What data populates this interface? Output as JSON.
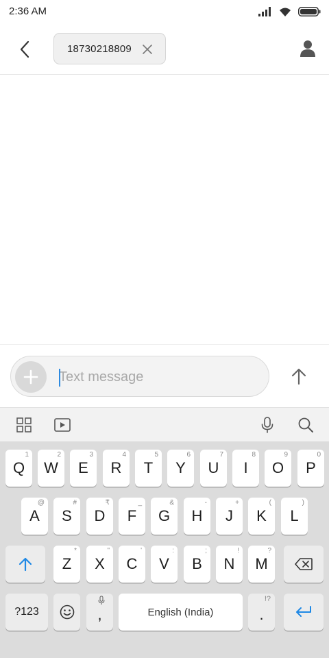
{
  "status_bar": {
    "time": "2:36 AM",
    "icons": [
      "signal-icon",
      "wifi-icon",
      "battery-icon"
    ]
  },
  "header": {
    "back_icon": "chevron-left-icon",
    "recipient": "18730218809",
    "remove_icon": "close-icon",
    "contact_icon": "person-icon"
  },
  "compose": {
    "placeholder": "Text message",
    "value": "",
    "add_icon": "plus-icon",
    "send_icon": "arrow-up-icon"
  },
  "keyboard_toolbar": {
    "icons": [
      "grid-icon",
      "sticker-play-icon",
      "microphone-icon",
      "search-icon"
    ]
  },
  "keyboard": {
    "row1": [
      {
        "label": "Q",
        "hint": "1"
      },
      {
        "label": "W",
        "hint": "2"
      },
      {
        "label": "E",
        "hint": "3"
      },
      {
        "label": "R",
        "hint": "4"
      },
      {
        "label": "T",
        "hint": "5"
      },
      {
        "label": "Y",
        "hint": "6"
      },
      {
        "label": "U",
        "hint": "7"
      },
      {
        "label": "I",
        "hint": "8"
      },
      {
        "label": "O",
        "hint": "9"
      },
      {
        "label": "P",
        "hint": "0"
      }
    ],
    "row2": [
      {
        "label": "A",
        "hint": "@"
      },
      {
        "label": "S",
        "hint": "#"
      },
      {
        "label": "D",
        "hint": "₹"
      },
      {
        "label": "F",
        "hint": "_"
      },
      {
        "label": "G",
        "hint": "&"
      },
      {
        "label": "H",
        "hint": "-"
      },
      {
        "label": "J",
        "hint": "+"
      },
      {
        "label": "K",
        "hint": "("
      },
      {
        "label": "L",
        "hint": ")"
      }
    ],
    "row3": [
      {
        "label": "Z",
        "hint": "*"
      },
      {
        "label": "X",
        "hint": "\""
      },
      {
        "label": "C",
        "hint": "'"
      },
      {
        "label": "V",
        "hint": ":"
      },
      {
        "label": "B",
        "hint": ";"
      },
      {
        "label": "N",
        "hint": "!"
      },
      {
        "label": "M",
        "hint": "?"
      }
    ],
    "shift_icon": "shift-arrow-icon",
    "backspace_icon": "backspace-icon",
    "symbols_label": "?123",
    "emoji_icon": "emoji-icon",
    "comma_label": ",",
    "comma_icon": "microphone-icon",
    "space_label": "English (India)",
    "period_label": ".",
    "period_hint": "!?",
    "enter_icon": "enter-icon",
    "accent_color": "#1e88e5"
  }
}
